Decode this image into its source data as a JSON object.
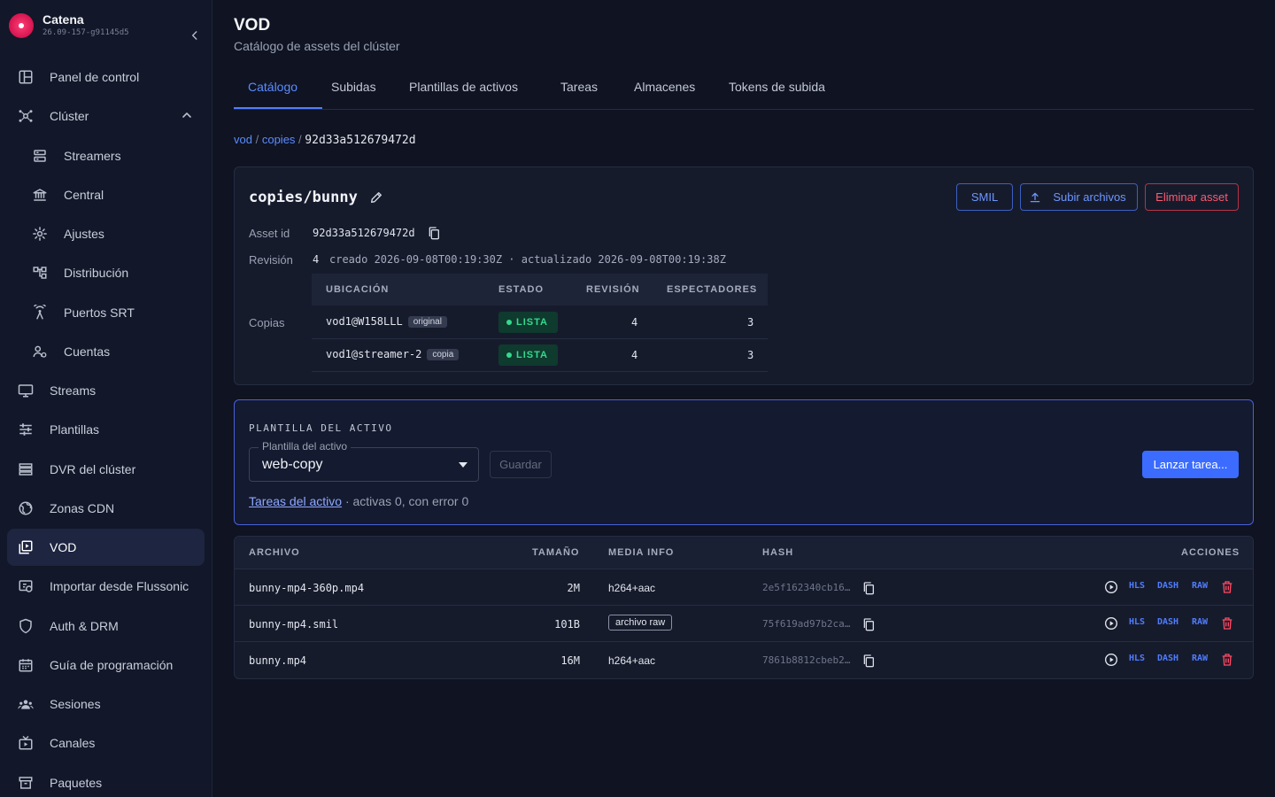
{
  "brand": {
    "name": "Catena",
    "version": "26.09-157-g91145d5"
  },
  "sidebar": {
    "items": [
      {
        "label": "Panel de control",
        "icon": "dashboard-icon"
      },
      {
        "label": "Clúster",
        "icon": "cluster-icon",
        "expanded": true
      },
      {
        "label": "Streamers",
        "icon": "server-icon",
        "sub": true
      },
      {
        "label": "Central",
        "icon": "bank-icon",
        "sub": true
      },
      {
        "label": "Ajustes",
        "icon": "gear-icon",
        "sub": true
      },
      {
        "label": "Distribución",
        "icon": "distribution-icon",
        "sub": true
      },
      {
        "label": "Puertos SRT",
        "icon": "antenna-icon",
        "sub": true
      },
      {
        "label": "Cuentas",
        "icon": "users-icon",
        "sub": true
      },
      {
        "label": "Streams",
        "icon": "monitor-icon"
      },
      {
        "label": "Plantillas",
        "icon": "sliders-icon"
      },
      {
        "label": "DVR del clúster",
        "icon": "list-icon"
      },
      {
        "label": "Zonas CDN",
        "icon": "globe-icon"
      },
      {
        "label": "VOD",
        "icon": "video-library-icon",
        "active": true
      },
      {
        "label": "Importar desde Flussonic",
        "icon": "import-icon"
      },
      {
        "label": "Auth & DRM",
        "icon": "shield-icon"
      },
      {
        "label": "Guía de programación",
        "icon": "calendar-icon"
      },
      {
        "label": "Sesiones",
        "icon": "group-icon"
      },
      {
        "label": "Canales",
        "icon": "tv-icon"
      },
      {
        "label": "Paquetes",
        "icon": "archive-icon"
      }
    ]
  },
  "header": {
    "title": "VOD",
    "subtitle": "Catálogo de assets del clúster"
  },
  "tabs": [
    "Catálogo",
    "Subidas",
    "Plantillas de activos",
    "Tareas",
    "Almacenes",
    "Tokens de subida"
  ],
  "breadcrumb": {
    "root": "vod",
    "sep": "/",
    "parent": "copies",
    "current": "92d33a512679472d"
  },
  "asset": {
    "name": "copies/bunny",
    "buttons": {
      "smil": "SMIL",
      "upload": "Subir archivos",
      "delete": "Eliminar asset"
    },
    "asset_id_label": "Asset id",
    "asset_id": "92d33a512679472d",
    "revision_label": "Revisión",
    "revision": "4",
    "revision_info": "creado 2026-09-08T00:19:30Z · actualizado 2026-09-08T00:19:38Z",
    "copies_label": "Copias",
    "copies_headers": [
      "UBICACIÓN",
      "ESTADO",
      "REVISIÓN",
      "ESPECTADORES"
    ],
    "copies": [
      {
        "location": "vod1@W158LLL",
        "tag": "original",
        "status": "LISTA",
        "revision": "4",
        "viewers": "3"
      },
      {
        "location": "vod1@streamer-2",
        "tag": "copia",
        "status": "LISTA",
        "revision": "4",
        "viewers": "3"
      }
    ]
  },
  "template": {
    "title": "PLANTILLA DEL ACTIVO",
    "select_label": "Plantilla del activo",
    "select_value": "web-copy",
    "save": "Guardar",
    "launch": "Lanzar tarea...",
    "tasks_link": "Tareas del activo",
    "tasks_info": " · activas 0, con error 0"
  },
  "files": {
    "headers": {
      "file": "ARCHIVO",
      "size": "TAMAÑO",
      "media": "MEDIA INFO",
      "hash": "HASH",
      "actions": "ACCIONES"
    },
    "action_labels": {
      "hls": "HLS",
      "dash": "DASH",
      "raw": "RAW"
    },
    "rows": [
      {
        "name": "bunny-mp4-360p.mp4",
        "size": "2M",
        "media": "h264+aac",
        "hash": "2e5f162340cb16…"
      },
      {
        "name": "bunny-mp4.smil",
        "size": "101B",
        "media_badge": "archivo raw",
        "hash": "75f619ad97b2ca…"
      },
      {
        "name": "bunny.mp4",
        "size": "16M",
        "media": "h264+aac",
        "hash": "7861b8812cbeb2…"
      }
    ]
  },
  "colors": {
    "accent": "#4f7dff",
    "danger": "#ff5a6f",
    "success": "#35d98f",
    "brand": "#ff3e76"
  }
}
